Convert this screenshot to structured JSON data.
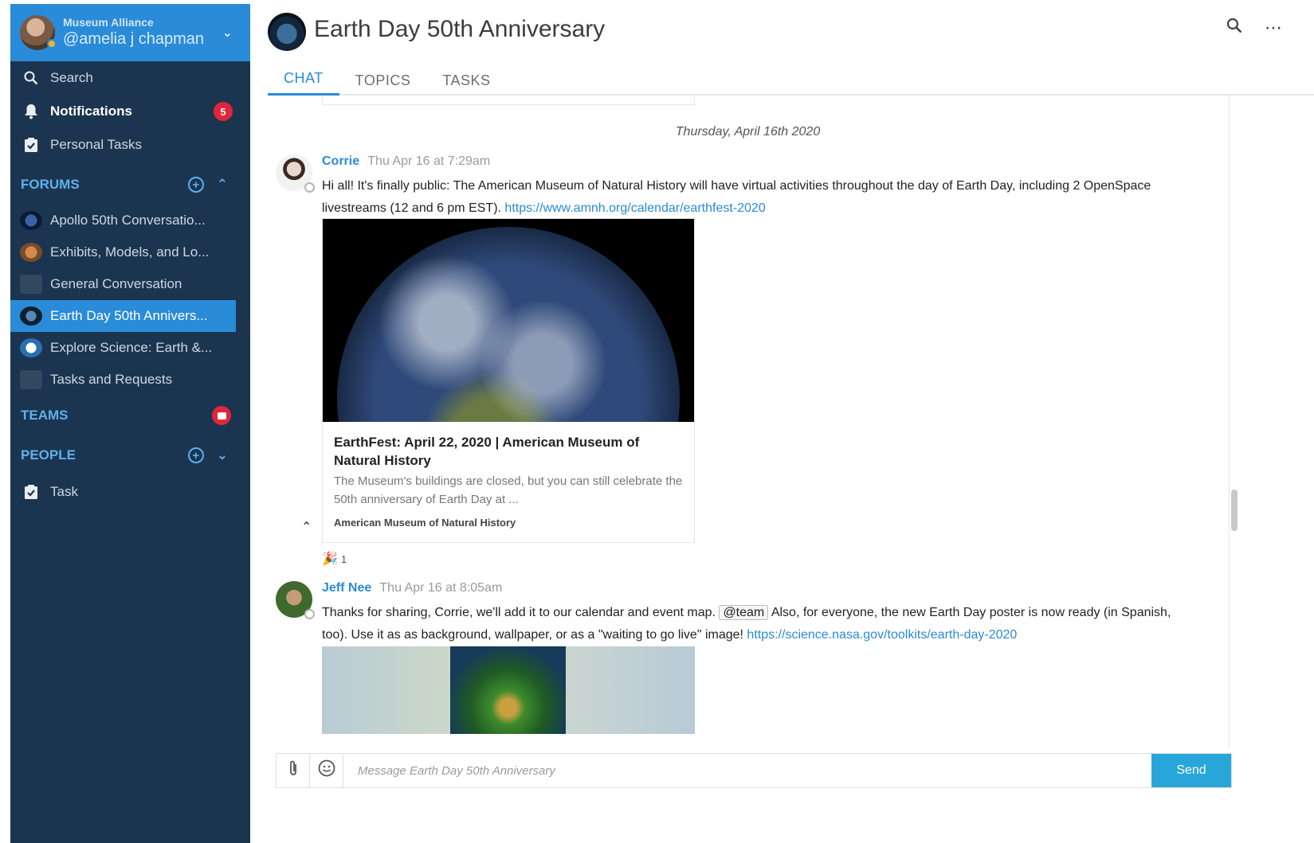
{
  "workspace": {
    "org": "Museum Alliance",
    "user": "@amelia j chapman"
  },
  "nav": {
    "search": "Search",
    "notifications": "Notifications",
    "notifications_count": "5",
    "personal_tasks": "Personal Tasks"
  },
  "forums": {
    "heading": "FORUMS",
    "items": [
      {
        "label": "Apollo 50th Conversatio..."
      },
      {
        "label": "Exhibits, Models, and Lo..."
      },
      {
        "label": "General Conversation"
      },
      {
        "label": "Earth Day 50th Annivers..."
      },
      {
        "label": "Explore Science: Earth &..."
      },
      {
        "label": "Tasks and Requests"
      }
    ]
  },
  "teams": {
    "heading": "TEAMS"
  },
  "people": {
    "heading": "PEOPLE",
    "items": [
      {
        "label": "Task"
      }
    ]
  },
  "channel": {
    "title": "Earth Day 50th Anniversary",
    "tabs": [
      "CHAT",
      "TOPICS",
      "TASKS"
    ],
    "date_separator": "Thursday, April 16th 2020"
  },
  "messages": [
    {
      "author": "Corrie",
      "time": "Thu Apr 16 at 7:29am",
      "text": "Hi all! It's finally public: The American Museum of Natural History will have virtual activities throughout the day of Earth Day, including 2 OpenSpace livestreams (12 and 6 pm EST).",
      "link": "https://www.amnh.org/calendar/earthfest-2020",
      "card": {
        "title": "EarthFest: April 22, 2020 | American Museum of Natural History",
        "desc": "The Museum's buildings are closed, but you can still celebrate the 50th anniversary of Earth Day at ...",
        "source": "American Museum of Natural History"
      },
      "reaction_count": "1"
    },
    {
      "author": "Jeff Nee",
      "time": "Thu Apr 16 at 8:05am",
      "text_before": "Thanks for sharing, Corrie, we'll add it to our calendar and event map.",
      "mention": "@team",
      "text_after": "Also, for everyone, the new Earth Day poster is now ready (in Spanish, too). Use it as as background, wallpaper, or as a \"waiting to go live\" image!",
      "link": "https://science.nasa.gov/toolkits/earth-day-2020"
    }
  ],
  "composer": {
    "placeholder": "Message Earth Day 50th Anniversary",
    "send": "Send"
  }
}
